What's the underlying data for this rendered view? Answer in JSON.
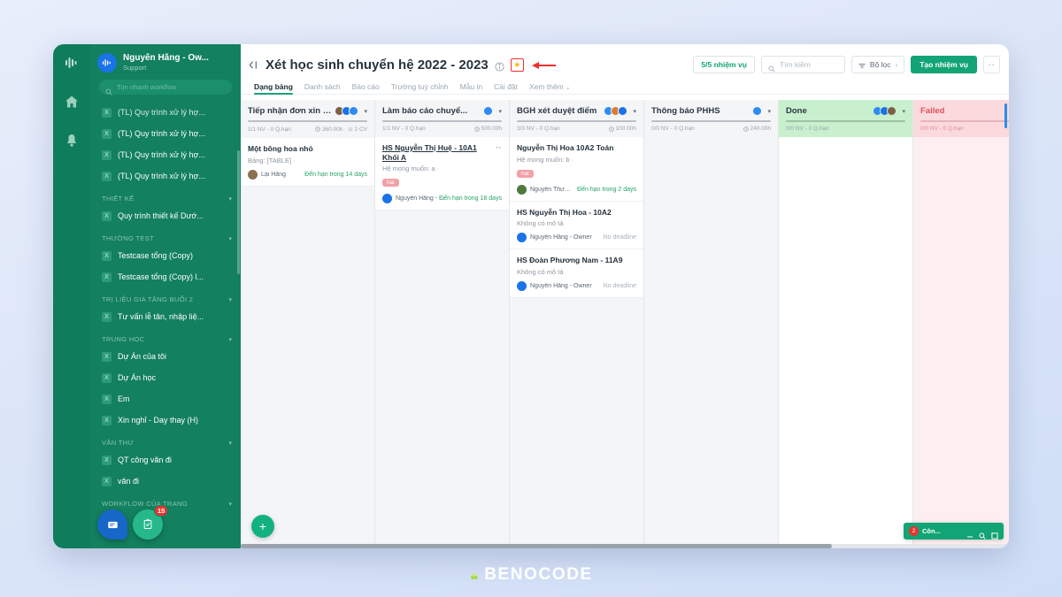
{
  "watermark": {
    "text": "BENOCODE",
    "mark_icon": "benocode-logo-icon"
  },
  "rail": {
    "items": [
      {
        "name": "logo-icon",
        "label": "Benocode"
      },
      {
        "name": "home-icon",
        "label": "Trang chủ"
      },
      {
        "name": "bell-icon",
        "label": "Thông báo"
      }
    ]
  },
  "sidebar": {
    "workspace": {
      "name": "Nguyễn Hằng - Ow...",
      "sub": "Support",
      "avatar_icon": "workspace-avatar-icon"
    },
    "search_placeholder": "Tìm nhanh workflow",
    "items": [
      {
        "label": "(TL) Quy trình xử lý hợ...",
        "icon": "workflow-file-icon"
      },
      {
        "label": "(TL) Quy trình xử lý hợ...",
        "icon": "workflow-file-icon"
      },
      {
        "label": "(TL) Quy trình xử lý hợ...",
        "icon": "workflow-file-icon"
      },
      {
        "label": "(TL) Quy trình xử lý hợ...",
        "icon": "workflow-file-icon"
      }
    ],
    "groups": [
      {
        "label": "THIẾT KẾ",
        "items": [
          {
            "label": "Quy trình thiết kế Dướ...",
            "icon": "workflow-file-icon"
          }
        ]
      },
      {
        "label": "THƯỜNG TEST",
        "items": [
          {
            "label": "Testcase tổng (Copy)",
            "icon": "workflow-file-icon"
          },
          {
            "label": "Testcase tổng (Copy) l...",
            "icon": "workflow-file-icon"
          }
        ]
      },
      {
        "label": "TRỊ LIỆU GIA TĂNG BUỔI 2",
        "items": [
          {
            "label": "Tư vấn lễ tân, nhập liệ...",
            "icon": "workflow-file-icon"
          }
        ]
      },
      {
        "label": "TRUNG HỌC",
        "items": [
          {
            "label": "Dự Án của tôi",
            "icon": "workflow-file-icon"
          },
          {
            "label": "Dự Án học",
            "icon": "workflow-file-icon"
          },
          {
            "label": "Em",
            "icon": "workflow-file-icon"
          },
          {
            "label": "Xin nghỉ - Day thay (H)",
            "icon": "workflow-file-icon"
          }
        ]
      },
      {
        "label": "VĂN THƯ",
        "items": [
          {
            "label": "QT công văn đi",
            "icon": "workflow-file-icon"
          },
          {
            "label": "văn đi",
            "icon": "workflow-file-icon"
          }
        ]
      },
      {
        "label": "WORKFLOW CỦA TRANG",
        "items": []
      }
    ],
    "fab_chat_icon": "chat-bubble-icon",
    "fab_task_icon": "clipboard-check-icon",
    "fab_badge": "15"
  },
  "header": {
    "collapse_icon": "collapse-panel-icon",
    "title": "Xét học sinh chuyển hệ 2022 - 2023",
    "info_icon": "info-circle-icon",
    "star_icon": "star-icon",
    "arrow_icon": "red-arrow-icon",
    "task_count": "5/5 nhiệm vụ",
    "search_placeholder": "Tìm kiếm",
    "search_icon": "search-icon",
    "filter_label": "Bộ lọc",
    "filter_icon": "filter-icon",
    "filter_chevron": "›",
    "create_task_label": "Tạo nhiệm vụ",
    "more_label": "··"
  },
  "tabs": [
    {
      "label": "Dạng bảng",
      "active": true
    },
    {
      "label": "Danh sách",
      "active": false
    },
    {
      "label": "Báo cáo",
      "active": false
    },
    {
      "label": "Trường tuỳ chỉnh",
      "active": false
    },
    {
      "label": "Mẫu in",
      "active": false
    },
    {
      "label": "Cài đặt",
      "active": false
    },
    {
      "label": "Xem thêm",
      "active": false,
      "caret": "⌄"
    }
  ],
  "board": {
    "add_card_icon": "add-card-icon",
    "columns": [
      {
        "title": "Tiếp nhận đơn xin c...",
        "meta_left": "1/1 NV - 0 Q.hạn",
        "meta_right": "360.00h · ⊙ 2 CV",
        "avatars": [
          "#7d6046",
          "#1a73e8",
          "#2d8cf0"
        ],
        "cards": [
          {
            "title": "Một bông hoa nhỏ",
            "desc": "Bảng: [TABLE] ·",
            "tag": null,
            "assignee": "Lại Hằng",
            "avatar_color": "#8a7250",
            "due": "Đến hạn trong 14 days",
            "due_state": "ok",
            "underline": false,
            "dots": false
          }
        ]
      },
      {
        "title": "Làm báo cáo chuyể...",
        "meta_left": "1/1 NV - 0 Q.hạn",
        "meta_right": "500.00h",
        "avatars": [
          "#2d8cf0"
        ],
        "cards": [
          {
            "title": "HS Nguyễn Thị Huệ - 10A1 Khối A",
            "desc": "Hệ mong muốn: a ·",
            "tag": "hai",
            "assignee": "Nguyễn Hằng - Owner",
            "avatar_color": "#1a73e8",
            "due": "Đến hạn trong 18 days",
            "due_state": "overlap",
            "underline": true,
            "dots": true
          }
        ]
      },
      {
        "title": "BGH xét duyệt điểm",
        "meta_left": "3/3 NV - 0 Q.hạn",
        "meta_right": "100.00h",
        "avatars": [
          "#2d8cf0",
          "#e07a2f",
          "#1a73e8"
        ],
        "cards": [
          {
            "title": "Nguyễn Thị Hoa 10A2 Toán",
            "desc": "Hệ mong muốn: b ·",
            "tag": "hai",
            "assignee": "Nguyễn Thương",
            "avatar_color": "#4e7a3c",
            "due": "Đến hạn trong 2 days",
            "due_state": "ok",
            "underline": false,
            "dots": false
          },
          {
            "title": "HS Nguyễn Thị Hoa - 10A2",
            "desc": "Không có mô tả",
            "tag": null,
            "assignee": "Nguyễn Hằng - Owner",
            "avatar_color": "#1a73e8",
            "due": "No deadline",
            "due_state": "none",
            "underline": false,
            "dots": false
          },
          {
            "title": "HS Đoàn Phương Nam - 11A9",
            "desc": "Không có mô tả",
            "tag": null,
            "assignee": "Nguyễn Hằng - Owner",
            "avatar_color": "#1a73e8",
            "due": "No deadline",
            "due_state": "none",
            "underline": false,
            "dots": false
          }
        ]
      },
      {
        "title": "Thông báo PHHS",
        "meta_left": "0/0 NV - 0 Q.hạn",
        "meta_right": "240.00h",
        "avatars": [
          "#2d8cf0"
        ],
        "cards": []
      },
      {
        "title": "Done",
        "meta_left": "0/0 NV - 0 Q.hạn",
        "meta_right": "",
        "avatars": [
          "#2d8cf0",
          "#1a73e8",
          "#7d6046"
        ],
        "cards": [],
        "style": "done"
      },
      {
        "title": "Failed",
        "meta_left": "0/0 NV - 0 Q.hạn",
        "meta_right": "",
        "avatars": [
          "#2d8cf0"
        ],
        "cards": [],
        "style": "failed"
      }
    ]
  },
  "chat_widget": {
    "badge": "2",
    "label": "Côn...",
    "minimize_icon": "minimize-icon",
    "search_icon": "search-icon",
    "expand_icon": "expand-icon"
  }
}
